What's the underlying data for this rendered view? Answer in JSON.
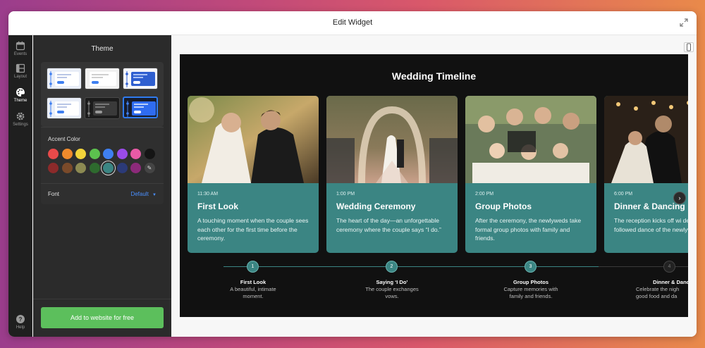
{
  "window": {
    "title": "Edit Widget"
  },
  "nav": [
    {
      "label": "Events",
      "icon": "calendar-icon"
    },
    {
      "label": "Layout",
      "icon": "layout-icon"
    },
    {
      "label": "Theme",
      "icon": "palette-icon"
    },
    {
      "label": "Settings",
      "icon": "gear-icon"
    }
  ],
  "help": {
    "label": "Help",
    "icon": "help-icon"
  },
  "panel": {
    "title": "Theme",
    "accent_label": "Accent Color",
    "font_label": "Font",
    "font_value": "Default",
    "add_button": "Add to website for free"
  },
  "colors": {
    "accent_row1": [
      "#e84a4a",
      "#ef8a2c",
      "#f2d43a",
      "#5cc14e",
      "#3f7ff0",
      "#9a4be8",
      "#e85aa6",
      "#151515"
    ],
    "accent_row2": [
      "#8c2a2a",
      "#7a4a2a",
      "#8c8a52",
      "#2e6a2e",
      "#3b8583",
      "#2b3a78",
      "#8c2a7a"
    ],
    "selected_accent": "#3b8583",
    "card_bg": "#3b8583",
    "add_button_bg": "#5cbf5c"
  },
  "widget": {
    "title": "Wedding Timeline",
    "events": [
      {
        "time": "11:30 AM",
        "title": "First Look",
        "desc": "A touching moment when the couple sees each other for the first time before the ceremony."
      },
      {
        "time": "1:00 PM",
        "title": "Wedding Ceremony",
        "desc": "The heart of the day—an unforgettable ceremony where the couple says “I do.”"
      },
      {
        "time": "2:00 PM",
        "title": "Group Photos",
        "desc": "After the ceremony, the newlyweds take formal group photos with family and friends."
      },
      {
        "time": "6:00 PM",
        "title": "Dinner & Dancing",
        "desc": "The reception kicks off wi delicious dinner followed dance of the newlyweds."
      }
    ],
    "timeline": [
      {
        "num": "1",
        "title": "First Look",
        "sub": "A beautiful, intimate moment."
      },
      {
        "num": "2",
        "title": "Saying ‘I Do’",
        "sub": "The couple exchanges vows."
      },
      {
        "num": "3",
        "title": "Group Photos",
        "sub": "Capture memories with family and friends."
      },
      {
        "num": "4",
        "title": "Dinner & Danc",
        "sub": "Celebrate the nigh good food and da"
      }
    ]
  }
}
